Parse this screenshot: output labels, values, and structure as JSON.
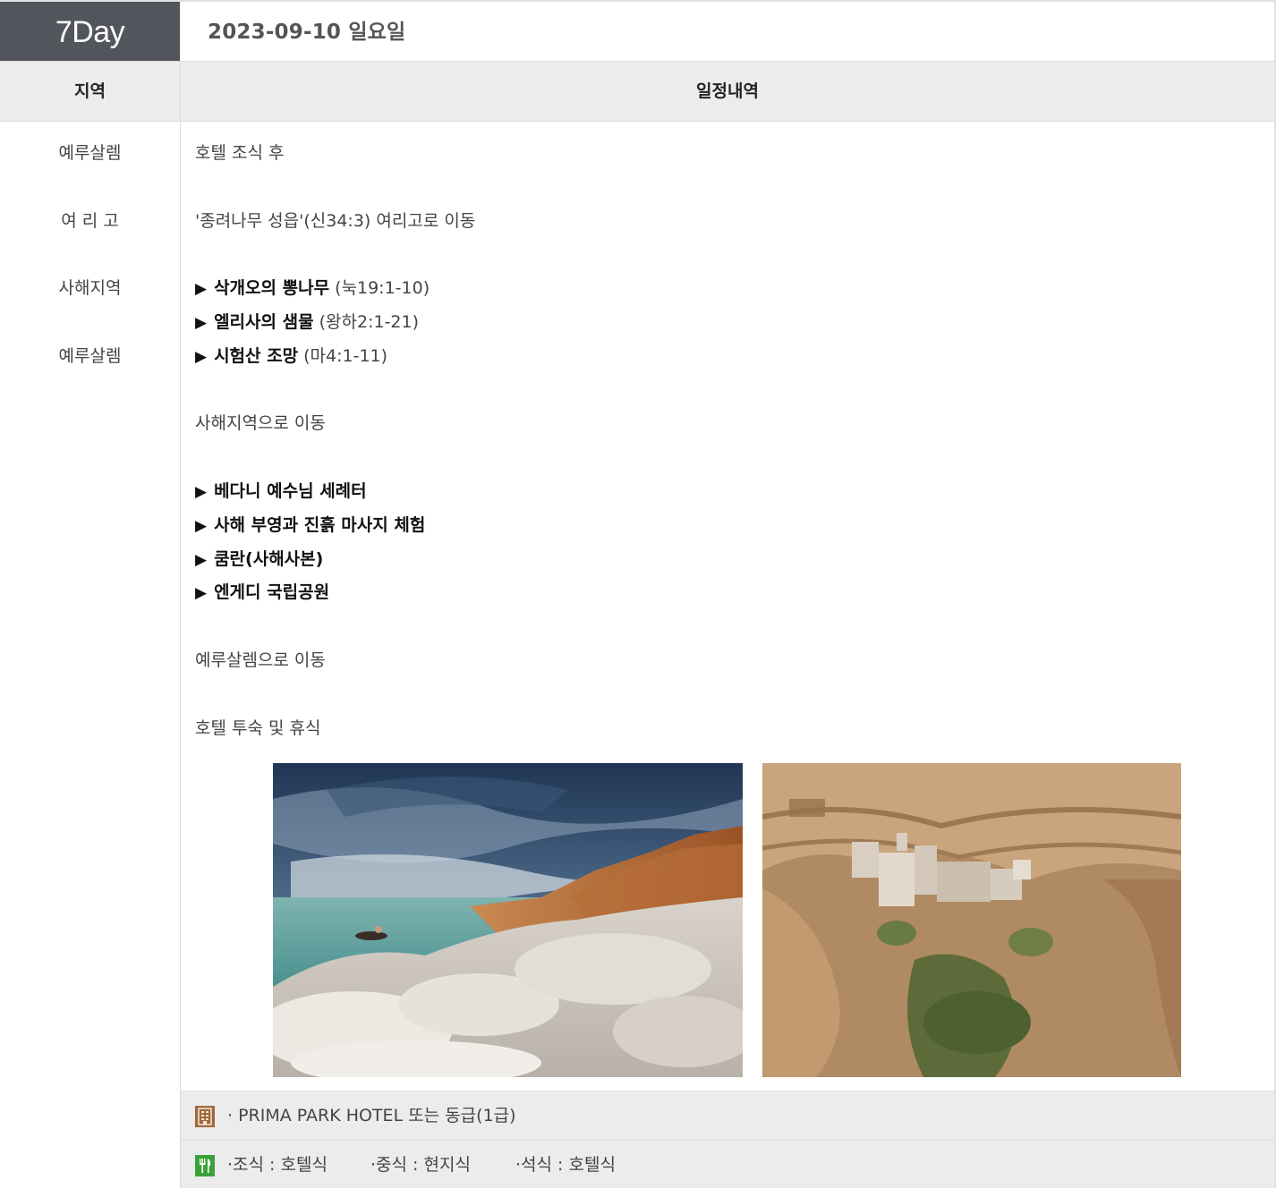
{
  "day": {
    "label": "7Day",
    "date": "2023-09-10 일요일"
  },
  "header": {
    "region": "지역",
    "schedule": "일정내역"
  },
  "regions": [
    "예루살렘",
    "여 리 고",
    "사해지역",
    "예루살렘"
  ],
  "schedule": {
    "l1": "호텔 조식 후",
    "l2": "'종려나무 성읍'(신34:3) 여리고로 이동",
    "l3": {
      "arrow": "▶",
      "name": "삭개오의 뽕나무",
      "ref": "(눅19:1-10)"
    },
    "l4": {
      "arrow": "▶",
      "name": "엘리사의 샘물",
      "ref": "(왕하2:1-21)"
    },
    "l5": {
      "arrow": "▶",
      "name": "시험산 조망",
      "ref": "(마4:1-11)"
    },
    "l6": "사해지역으로 이동",
    "l7": {
      "arrow": "▶",
      "name": "베다니 예수님 세례터"
    },
    "l8": {
      "arrow": "▶",
      "name": "사해 부영과 진흙 마사지 체험"
    },
    "l9": {
      "arrow": "▶",
      "name": "쿰란(사해사본)"
    },
    "l10": {
      "arrow": "▶",
      "name": "엔게디 국립공원"
    },
    "l11": "예루살렘으로 이동",
    "l12": "호텔 투숙 및 휴식"
  },
  "photos": {
    "left": "dead-sea-salt-shore-photo",
    "right": "desert-monastery-canyon-photo"
  },
  "hotel": {
    "icon": "hotel-icon",
    "text": "· PRIMA PARK HOTEL 또는 동급(1급)"
  },
  "meals": {
    "icon": "meal-icon",
    "breakfast": "·조식 : 호텔식",
    "lunch": "·중식 : 현지식",
    "dinner": "·석식 : 호텔식"
  },
  "colors": {
    "badge": "#53555c",
    "header_bg": "#ececec",
    "hotel_icon": "#a0683a",
    "meal_icon": "#3aa23a"
  }
}
